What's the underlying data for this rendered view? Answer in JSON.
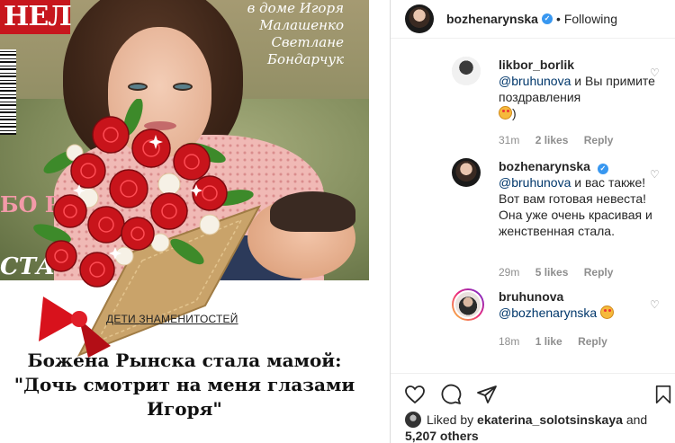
{
  "cover": {
    "logo": "НЕЛ",
    "text": "в доме Игоря Малашенко Светлане Бондарчук",
    "pink_letters": "БО РЫ",
    "sta": "СТА"
  },
  "article": {
    "category": "ДЕТИ ЗНАМЕНИТОСТЕЙ",
    "headline_line1": "Божена Рынска стала мамой:",
    "headline_line2": "\"Дочь смотрит на меня глазами",
    "headline_line3": "Игоря\""
  },
  "post_header": {
    "username": "bozhenarynska",
    "dot": "•",
    "following": "Following"
  },
  "comments": [
    {
      "username": "likbor_borlik",
      "mention": "@bruhunova",
      "text": "и Вы примите поздравления",
      "tail": ")",
      "time": "31m",
      "likes": "2 likes",
      "reply": "Reply"
    },
    {
      "username": "bozhenarynska",
      "mention": "@bruhunova",
      "text": "и вас также! Вот вам готовая невеста! Она уже очень красивая и женственная стала.",
      "time": "29m",
      "likes": "5 likes",
      "reply": "Reply"
    },
    {
      "username": "bruhunova",
      "mention": "@bozhenarynska",
      "text": "",
      "time": "18m",
      "likes": "1 like",
      "reply": "Reply"
    }
  ],
  "likes_line": {
    "prefix": "Liked by",
    "user": "ekaterina_solotsinskaya",
    "and": "and",
    "others": "5,207 others"
  },
  "icons": [
    "heart-icon",
    "comment-icon",
    "share-icon",
    "bookmark-icon",
    "verified-icon"
  ],
  "colors": {
    "accent": "#3897f0",
    "link": "#00376b",
    "muted": "#8e8e8e",
    "rose": "#c8141b"
  }
}
